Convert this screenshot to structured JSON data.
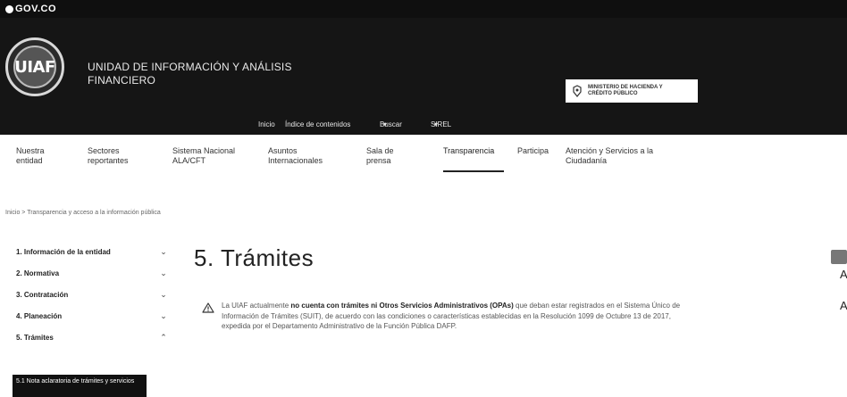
{
  "govbar": {
    "logo_text": "GOV.CO"
  },
  "header": {
    "seal_text": "UIAF",
    "entity_name_line1": "UNIDAD DE INFORMACIÓN Y ANÁLISIS",
    "entity_name_line2": "FINANCIERO",
    "ministry_line1": "MINISTERIO DE HACIENDA Y",
    "ministry_line2": "CRÉDITO PÚBLICO"
  },
  "topnav": {
    "inicio": "Inicio",
    "indice": "Índice de contenidos",
    "buscar": "Buscar",
    "sirel": "SIREL"
  },
  "mainnav": {
    "items": [
      {
        "line1": "Nuestra",
        "line2": "entidad"
      },
      {
        "line1": "Sectores",
        "line2": "reportantes"
      },
      {
        "line1": "Sistema Nacional",
        "line2": "ALA/CFT"
      },
      {
        "line1": "Asuntos",
        "line2": "Internacionales"
      },
      {
        "line1": "Sala de",
        "line2": "prensa"
      },
      {
        "line1": "Transparencia",
        "line2": ""
      },
      {
        "line1": "Participa",
        "line2": ""
      },
      {
        "line1": "Atención y Servicios a la",
        "line2": "Ciudadanía"
      }
    ]
  },
  "breadcrumb": "Inicio > Transparencia y acceso a la información pública",
  "sidebar": {
    "items": [
      {
        "label": "1. Información de la entidad"
      },
      {
        "label": "2. Normativa"
      },
      {
        "label": "3. Contratación"
      },
      {
        "label": "4. Planeación"
      },
      {
        "label": "5. Trámites"
      }
    ],
    "sub_item": "5.1 Nota aclaratoria de trámites y servicios"
  },
  "content": {
    "title": "5. Trámites",
    "notice_pre": "La UIAF actualmente ",
    "notice_bold": "no cuenta con trámites ni Otros Servicios Administrativos (OPAs)",
    "notice_post": " que deban estar registrados en el Sistema Único de Información de Trámites (SUIT), de acuerdo con las condiciones o características establecidas en la Resolución 1099 de Octubre 13 de 2017, expedida por el Departamento Administrativo de la Función Pública DAFP."
  },
  "edge": {
    "a1": "A",
    "a2": "A"
  }
}
